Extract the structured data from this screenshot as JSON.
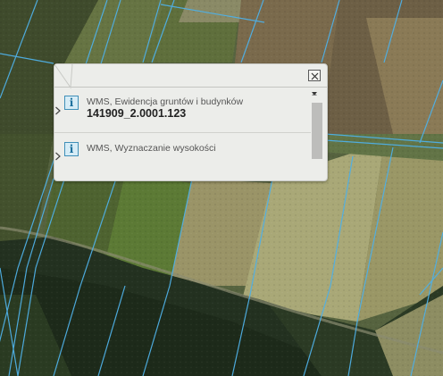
{
  "map": {
    "type": "satellite imagery with cadastral parcel boundaries",
    "parcel_line_color": "#4fb0e6"
  },
  "popup": {
    "close_icon": "close-icon",
    "items": [
      {
        "icon": "info-icon",
        "icon_glyph": "i",
        "title": "WMS, Ewidencja gruntów i budynków",
        "value": "141909_2.0001.123",
        "chevron": "chevron-right-icon"
      },
      {
        "icon": "info-icon",
        "icon_glyph": "i",
        "title": "WMS, Wyznaczanie wysokości",
        "chevron": "chevron-right-icon"
      }
    ],
    "scrollbar": {
      "up_icon": "scroll-up-arrow-icon",
      "down_icon": "scroll-down-arrow-icon"
    }
  },
  "colors": {
    "popup_background": "#ecedea",
    "info_icon_accent": "#3f8fb8"
  }
}
